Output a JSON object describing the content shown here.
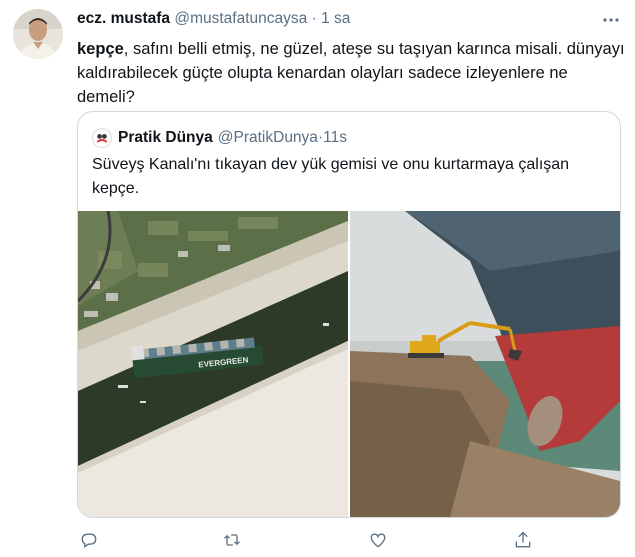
{
  "tweet": {
    "author_name": "ecz. mustafa",
    "author_handle": "@mustafatuncaysa",
    "separator": "·",
    "time": "1 sa",
    "text_bold": "kepçe",
    "text_rest": ", safını belli etmiş, ne güzel, ateşe su taşıyan karınca misali. dünyayı kaldırabilecek güçte olupta kenardan olayları sadece izleyenlere ne demeli?"
  },
  "quoted": {
    "author_name": "Pratik Dünya",
    "author_handle": "@PratikDunya",
    "separator": "·",
    "time": "11s",
    "text": "Süveyş Kanalı'nı tıkayan dev yük gemisi ve onu kurtarmaya çalışan kepçe.",
    "ship_label": "EVERGREEN"
  },
  "icons": {
    "more": "more-dots-icon",
    "reply": "reply-icon",
    "retweet": "retweet-icon",
    "like": "heart-icon",
    "share": "share-icon"
  },
  "colors": {
    "text_primary": "#0f1419",
    "text_secondary": "#5b7083",
    "border": "#cfd9de"
  }
}
